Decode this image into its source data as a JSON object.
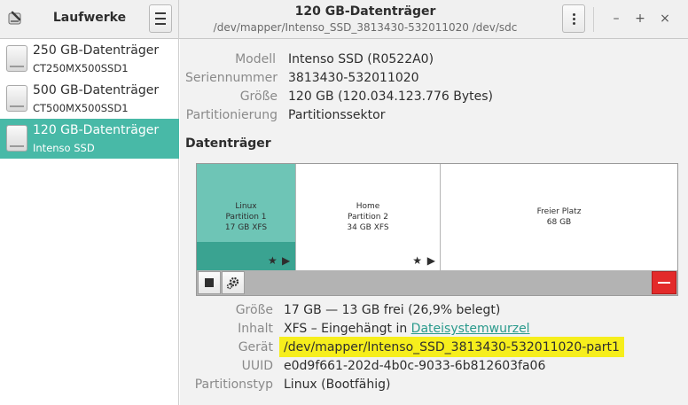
{
  "sidebar": {
    "title": "Laufwerke",
    "drives": [
      {
        "name": "250 GB-Datenträger",
        "model": "CT250MX500SSD1"
      },
      {
        "name": "500 GB-Datenträger",
        "model": "CT500MX500SSD1"
      },
      {
        "name": "120 GB-Datenträger",
        "model": "Intenso SSD"
      }
    ],
    "selected_index": 2
  },
  "header": {
    "title": "120 GB-Datenträger",
    "subtitle": "/dev/mapper/Intenso_SSD_3813430-532011020 /dev/sdc",
    "window_buttons": {
      "minimize": "–",
      "maximize": "+",
      "close": "×"
    }
  },
  "disk": {
    "model_label": "Modell",
    "model_value": "Intenso SSD (R0522A0)",
    "serial_label": "Seriennummer",
    "serial_value": "3813430-532011020",
    "size_label": "Größe",
    "size_value": "120 GB (120.034.123.776 Bytes)",
    "partitioning_label": "Partitionierung",
    "partitioning_value": "Partitionssektor"
  },
  "volumes": {
    "section_title": "Datenträger",
    "partitions": [
      {
        "line1": "Linux",
        "line2": "Partition 1",
        "line3": "17 GB XFS"
      },
      {
        "line1": "Home",
        "line2": "Partition 2",
        "line3": "34 GB XFS"
      },
      {
        "line1": "Freier Platz",
        "line2": "68 GB"
      }
    ],
    "selected_index": 0
  },
  "details": {
    "size_label": "Größe",
    "size_value": "17 GB — 13 GB frei (26,9% belegt)",
    "content_label": "Inhalt",
    "content_value": "XFS – Eingehängt in ",
    "content_link": "Dateisystemwurzel",
    "device_label": "Gerät",
    "device_value": "/dev/mapper/Intenso_SSD_3813430-532011020-part1",
    "uuid_label": "UUID",
    "uuid_value": "e0d9f661-202d-4b0c-9033-6b812603fa06",
    "type_label": "Partitionstyp",
    "type_value": "Linux (Bootfähig)"
  },
  "colors": {
    "accent": "#48b9a7",
    "highlight": "#f6ee1c",
    "delete": "#e32a2a"
  }
}
